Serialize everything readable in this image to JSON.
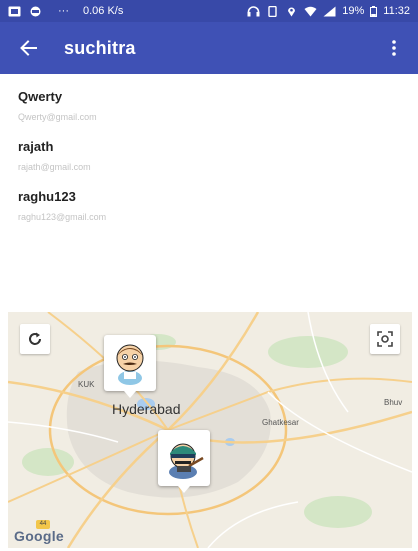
{
  "status_bar": {
    "speed": "0.06 K/s",
    "battery": "19%",
    "time": "11:32"
  },
  "app_bar": {
    "title": "suchitra",
    "back_icon": "arrow-back-icon",
    "menu_icon": "more-vert-icon"
  },
  "contacts": [
    {
      "name": "Qwerty",
      "email": "Qwerty@gmail.com"
    },
    {
      "name": "rajath",
      "email": "rajath@gmail.com"
    },
    {
      "name": "raghu123",
      "email": "raghu123@gmail.com"
    }
  ],
  "map": {
    "city": "Hyderabad",
    "places": {
      "kukatpally": "KUK",
      "ghatkesar": "Ghatkesar",
      "bhuvanagiri": "Bhuv"
    },
    "road_shield": "44",
    "google_logo": "Google",
    "refresh_icon": "refresh-icon",
    "locate_icon": "my-location-icon"
  },
  "colors": {
    "status_bar": "#3849a8",
    "app_bar": "#3f51b5",
    "map_land": "#f1ede3"
  }
}
